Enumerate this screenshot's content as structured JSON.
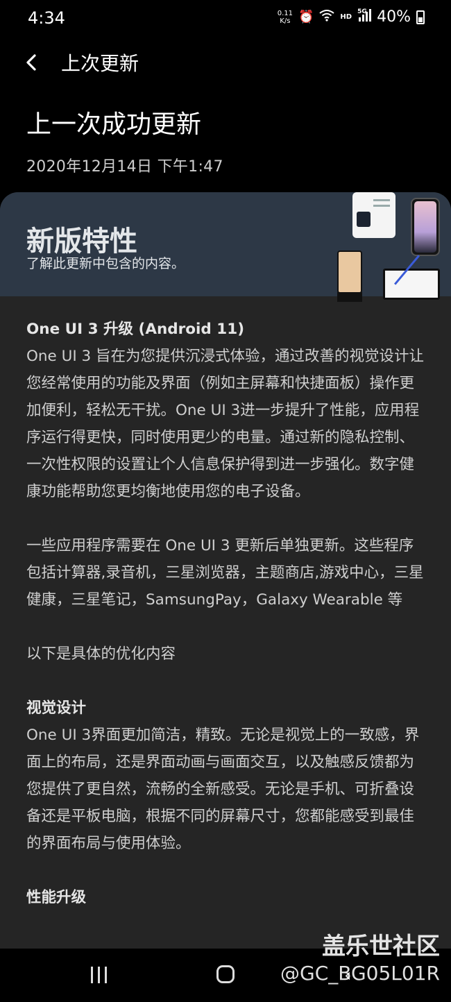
{
  "status_bar": {
    "time": "4:34",
    "net_speed_value": "0.11",
    "net_speed_unit": "K/s",
    "hd_label": "HD",
    "network_label": "5G",
    "battery_percent": "40%",
    "icons": [
      "alarm-icon",
      "wifi-icon",
      "signal-icon",
      "battery-icon"
    ]
  },
  "header": {
    "title": "上次更新"
  },
  "page": {
    "title": "上一次成功更新",
    "date": "2020年12月14日 下午1:47"
  },
  "banner": {
    "title": "新版特性",
    "subtitle": "了解此更新中包含的内容。",
    "background_color": "#2d3846"
  },
  "content": {
    "section1_title": "One UI 3 升级 (Android 11)",
    "section1_body": "One UI 3 旨在为您提供沉浸式体验，通过改善的视觉设计让您经常使用的功能及界面（例如主屏幕和快捷面板）操作更加便利，轻松无干扰。One UI 3进一步提升了性能，应用程序运行得更快，同时使用更少的电量。通过新的隐私控制、一次性权限的设置让个人信息保护得到进一步强化。数字健康功能帮助您更均衡地使用您的电子设备。",
    "para2": "一些应用程序需要在 One UI 3 更新后单独更新。这些程序包括计算器,录音机，三星浏览器，主题商店,游戏中心，三星健康，三星笔记，SamsungPay，Galaxy Wearable 等",
    "para3": "以下是具体的优化内容",
    "section2_title": "视觉设计",
    "section2_body": "One UI 3界面更加简洁，精致。无论是视觉上的一致感，界面上的布局，还是界面动画与画面交互，以及触感反馈都为您提供了更自然，流畅的全新感受。无论是手机、可折叠设备还是平板电脑，根据不同的屏幕尺寸，您都能感受到最佳的界面布局与使用体验。",
    "section3_title": "性能升级"
  },
  "watermark": {
    "line1": "盖乐世社区",
    "line2": "@GC_BG05L01R"
  },
  "colors": {
    "background": "#000000",
    "card": "#252525",
    "text": "#cfcfcf"
  }
}
